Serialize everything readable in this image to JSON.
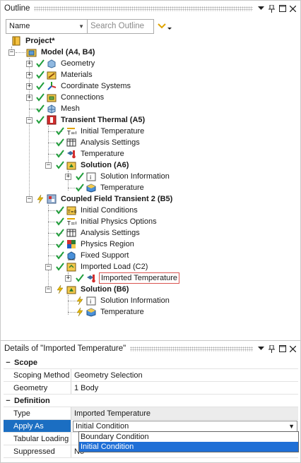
{
  "outline": {
    "title": "Outline",
    "filter_combo": "Name",
    "search_placeholder": "Search Outline"
  },
  "tree": {
    "project": "Project*",
    "model": "Model (A4, B4)",
    "geometry": "Geometry",
    "materials": "Materials",
    "coordinate_systems": "Coordinate Systems",
    "connections": "Connections",
    "mesh": "Mesh",
    "transient_thermal": "Transient Thermal (A5)",
    "tt_initial_temperature": "Initial Temperature",
    "tt_analysis_settings": "Analysis Settings",
    "tt_temperature": "Temperature",
    "tt_solution": "Solution (A6)",
    "tt_solution_information": "Solution Information",
    "tt_solution_temperature": "Temperature",
    "cft": "Coupled Field Transient 2 (B5)",
    "cft_initial_conditions": "Initial Conditions",
    "cft_initial_physics_options": "Initial Physics Options",
    "cft_analysis_settings": "Analysis Settings",
    "cft_physics_region": "Physics Region",
    "cft_fixed_support": "Fixed Support",
    "cft_imported_load": "Imported Load (C2)",
    "cft_imported_temperature": "Imported Temperature",
    "cft_solution": "Solution (B6)",
    "cft_solution_information": "Solution Information",
    "cft_solution_temperature": "Temperature"
  },
  "details": {
    "title": "Details of \"Imported Temperature\"",
    "scope_header": "Scope",
    "scoping_method_key": "Scoping Method",
    "scoping_method_val": "Geometry Selection",
    "geometry_key": "Geometry",
    "geometry_val": "1 Body",
    "definition_header": "Definition",
    "type_key": "Type",
    "type_val": "Imported Temperature",
    "apply_as_key": "Apply As",
    "apply_as_val": "Initial Condition",
    "tabular_loading_key": "Tabular Loading",
    "suppressed_key": "Suppressed",
    "suppressed_val": "No",
    "dropdown_options": [
      "Boundary Condition",
      "Initial Condition"
    ]
  },
  "colors": {
    "selection_blue": "#1b6ec2",
    "check_green": "#1f9e3a",
    "lightning_yellow": "#e6b800",
    "selected_border": "#d9534f"
  }
}
